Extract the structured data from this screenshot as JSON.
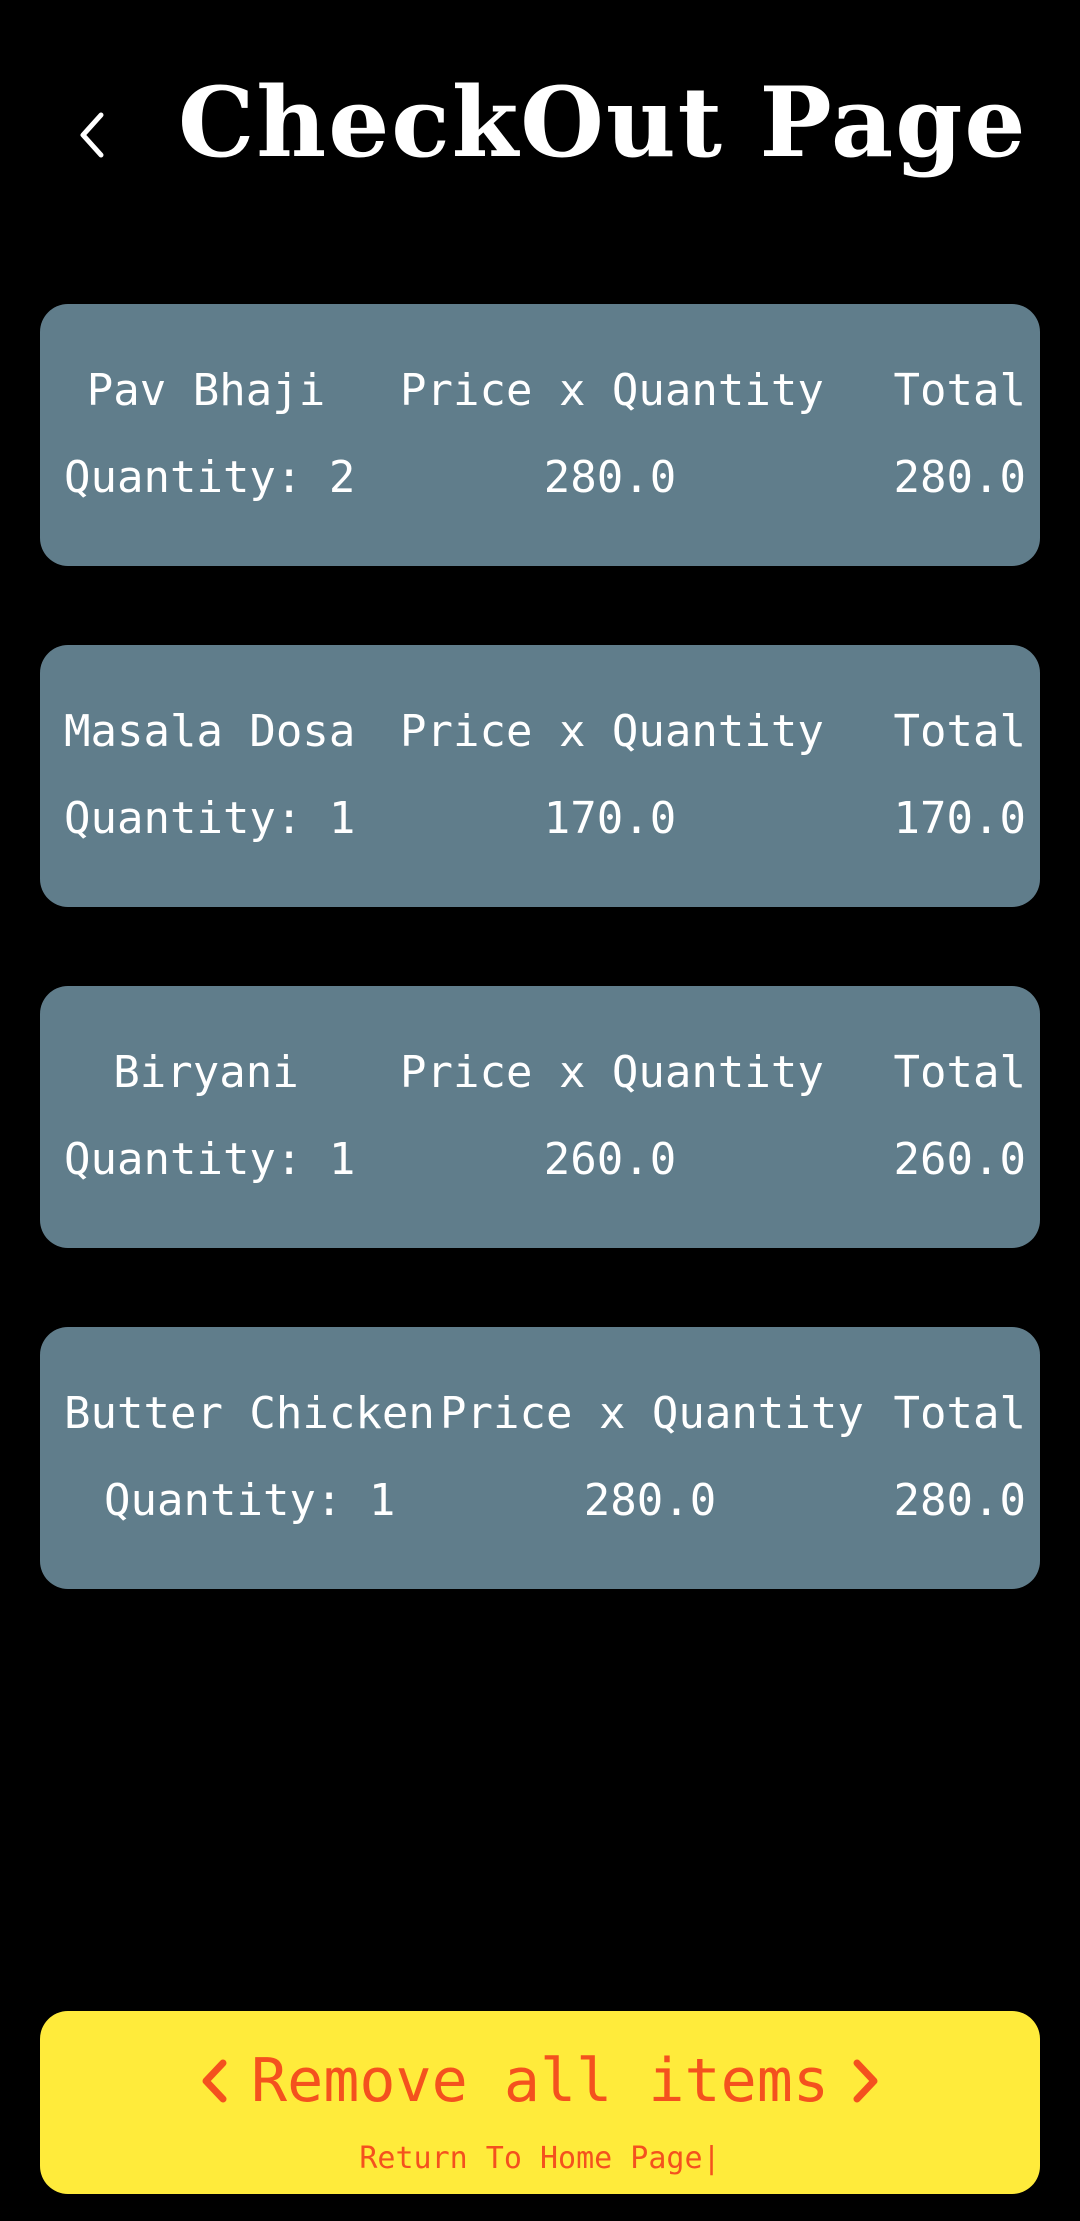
{
  "header": {
    "title": "CheckOut Page",
    "back_icon": "chevron-left-icon"
  },
  "items": [
    {
      "name": "Pav Bhaji",
      "price_header": "Price x Quantity",
      "total_header": "Total",
      "quantity": "Quantity: 2",
      "price_value": "280.0",
      "total_value": "280.0"
    },
    {
      "name": "Masala Dosa",
      "price_header": "Price x Quantity",
      "total_header": "Total",
      "quantity": "Quantity: 1",
      "price_value": "170.0",
      "total_value": "170.0"
    },
    {
      "name": "Biryani",
      "price_header": "Price x Quantity",
      "total_header": "Total",
      "quantity": "Quantity: 1",
      "price_value": "260.0",
      "total_value": "260.0"
    },
    {
      "name": "Butter Chicken",
      "price_header": "Price x Quantity",
      "total_header": "Total",
      "quantity": "Quantity: 1",
      "price_value": "280.0",
      "total_value": "280.0"
    }
  ],
  "action": {
    "label": "Remove all items",
    "sublabel": "Return To Home Page|",
    "left_icon": "chevron-left-icon",
    "right_icon": "chevron-right-icon"
  },
  "colors": {
    "background": "#000000",
    "card": "#607d8b",
    "action_bg": "#ffeb3b",
    "action_text": "#f4511e"
  }
}
